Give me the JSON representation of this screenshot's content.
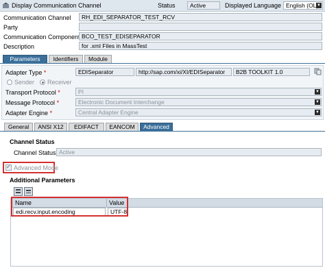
{
  "header": {
    "title": "Display Communication Channel",
    "status_label": "Status",
    "status_value": "Active",
    "lang_label": "Displayed Language",
    "lang_value": "English (OL)"
  },
  "top_fields": {
    "channel_label": "Communication Channel",
    "channel_value": "RH_EDI_SEPARATOR_TEST_RCV",
    "party_label": "Party",
    "party_value": "",
    "component_label": "Communication Component",
    "component_value": "BCO_TEST_EDISEPARATOR",
    "description_label": "Description",
    "description_value": "for .xml Files in MassTest"
  },
  "main_tabs": [
    "Parameters",
    "Identifiers",
    "Module"
  ],
  "params": {
    "adapter_type_label": "Adapter Type",
    "adapter_type_value": "EDISeparator",
    "adapter_ns": "http://sap.com/xi/XI/EDISeparator",
    "adapter_swcv": "B2B TOOLKIT 1.0",
    "sender_label": "Sender",
    "receiver_label": "Receiver",
    "transport_label": "Transport Protocol",
    "transport_value": "PI",
    "message_label": "Message Protocol",
    "message_value": "Electronic Document Interchange",
    "engine_label": "Adapter Engine",
    "engine_value": "Central Adapter Engine",
    "required_mark": "*"
  },
  "sub_tabs": [
    "General",
    "ANSI X12",
    "EDIFACT",
    "EANCOM",
    "Advanced"
  ],
  "advanced": {
    "channel_status_title": "Channel Status",
    "channel_status_label": "Channel Status",
    "channel_status_value": "Active",
    "advanced_mode_label": "Advanced Mode",
    "additional_params_title": "Additional Parameters",
    "table_headers": [
      "Name",
      "Value"
    ],
    "table_rows": [
      {
        "name": "edi.recv.input.encoding",
        "value": "UTF-8"
      }
    ]
  },
  "colors": {
    "accent": "#3b6f9a",
    "highlight": "#d32f2f"
  },
  "icons": [
    "header-app-icon",
    "copy-icon",
    "dropdown-arrow-icon",
    "insert-row-icon",
    "delete-row-icon"
  ]
}
